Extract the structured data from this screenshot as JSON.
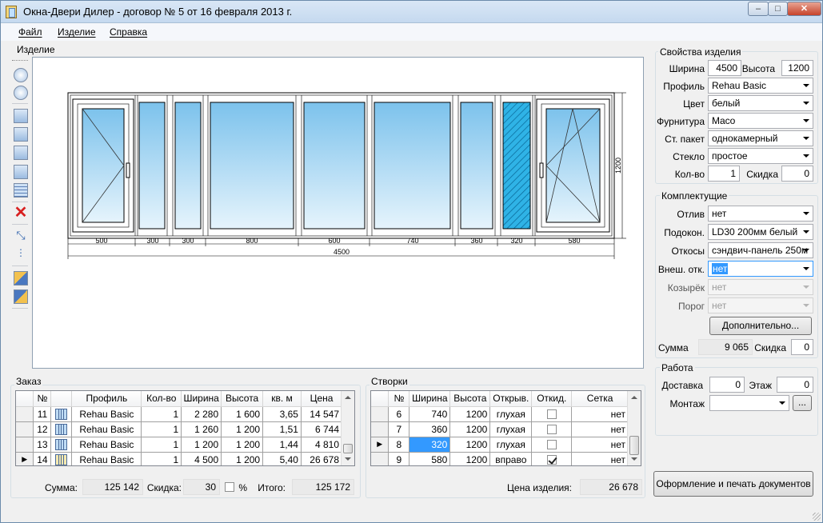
{
  "window": {
    "title": "Окна-Двери Дилер - договор № 5 от 16 февраля 2013 г.",
    "btn_min": "–",
    "btn_max": "□",
    "btn_close": "✕"
  },
  "menu": {
    "file": "Файл",
    "item": "Изделие",
    "help": "Справка"
  },
  "product_panel": {
    "label": "Изделие",
    "dimensions": {
      "sections": [
        "500",
        "300",
        "300",
        "800",
        "600",
        "740",
        "360",
        "320",
        "580"
      ],
      "total": "4500",
      "height": "1200"
    }
  },
  "properties": {
    "title": "Свойства изделия",
    "width_label": "Ширина",
    "width_value": "4500",
    "height_label": "Высота",
    "height_value": "1200",
    "profile_label": "Профиль",
    "profile_value": "Rehau Basic",
    "color_label": "Цвет",
    "color_value": "белый",
    "hardware_label": "Фурнитура",
    "hardware_value": "Maco",
    "glazing_label": "Ст. пакет",
    "glazing_value": "однокамерный",
    "glass_label": "Стекло",
    "glass_value": "простое",
    "qty_label": "Кол-во",
    "qty_value": "1",
    "discount_label": "Скидка",
    "discount_value": "0"
  },
  "accessories": {
    "title": "Комплектущие",
    "sill_label": "Отлив",
    "sill_value": "нет",
    "windowsill_label": "Подокон.",
    "windowsill_value": "LD30 200мм белый",
    "slopes_label": "Откосы",
    "slopes_value": "сэндвич-панель 250м",
    "ext_slopes_label": "Внеш. отк.",
    "ext_slopes_value": "нет",
    "visor_label": "Козырёк",
    "visor_value": "нет",
    "threshold_label": "Порог",
    "threshold_value": "нет",
    "more_button": "Дополнительно...",
    "sum_label": "Сумма",
    "sum_value": "9 065",
    "discount_label": "Скидка",
    "discount_value": "0"
  },
  "work": {
    "title": "Работа",
    "delivery_label": "Доставка",
    "delivery_value": "0",
    "floor_label": "Этаж",
    "floor_value": "0",
    "mount_label": "Монтаж",
    "mount_value": "",
    "browse_button": "..."
  },
  "order": {
    "title": "Заказ",
    "columns": [
      "№",
      "",
      "Профиль",
      "Кол-во",
      "Ширина",
      "Высота",
      "кв. м",
      "Цена"
    ],
    "rows": [
      {
        "no": "11",
        "profile": "Rehau Basic",
        "qty": "1",
        "width": "2 280",
        "height": "1 600",
        "area": "3,65",
        "price": "14 547",
        "icon": "window-icon"
      },
      {
        "no": "12",
        "profile": "Rehau Basic",
        "qty": "1",
        "width": "1 260",
        "height": "1 200",
        "area": "1,51",
        "price": "6 744",
        "icon": "window-icon"
      },
      {
        "no": "13",
        "profile": "Rehau Basic",
        "qty": "1",
        "width": "1 200",
        "height": "1 200",
        "area": "1,44",
        "price": "4 810",
        "icon": "window-icon"
      },
      {
        "no": "14",
        "profile": "Rehau Basic",
        "qty": "1",
        "width": "4 500",
        "height": "1 200",
        "area": "5,40",
        "price": "26 678",
        "icon": "door-icon"
      }
    ],
    "sum_label": "Сумма:",
    "sum_value": "125 142",
    "discount_label": "Скидка:",
    "discount_value": "30",
    "percent_label": "%",
    "total_label": "Итого:",
    "total_value": "125 172"
  },
  "sashes": {
    "title": "Створки",
    "columns": [
      "№",
      "Ширина",
      "Высота",
      "Открыв.",
      "Откид.",
      "Сетка"
    ],
    "rows": [
      {
        "no": "6",
        "width": "740",
        "height": "1200",
        "opening": "глухая",
        "tilt": false,
        "net": "нет"
      },
      {
        "no": "7",
        "width": "360",
        "height": "1200",
        "opening": "глухая",
        "tilt": false,
        "net": "нет"
      },
      {
        "no": "8",
        "width": "320",
        "height": "1200",
        "opening": "глухая",
        "tilt": false,
        "net": "нет"
      },
      {
        "no": "9",
        "width": "580",
        "height": "1200",
        "opening": "вправо",
        "tilt": true,
        "net": "нет"
      }
    ],
    "price_label": "Цена изделия:",
    "price_value": "26 678"
  },
  "print_button": "Оформление и печать документов",
  "colors": {
    "glass": "#9fd4f2",
    "selection": "#3399ff"
  }
}
